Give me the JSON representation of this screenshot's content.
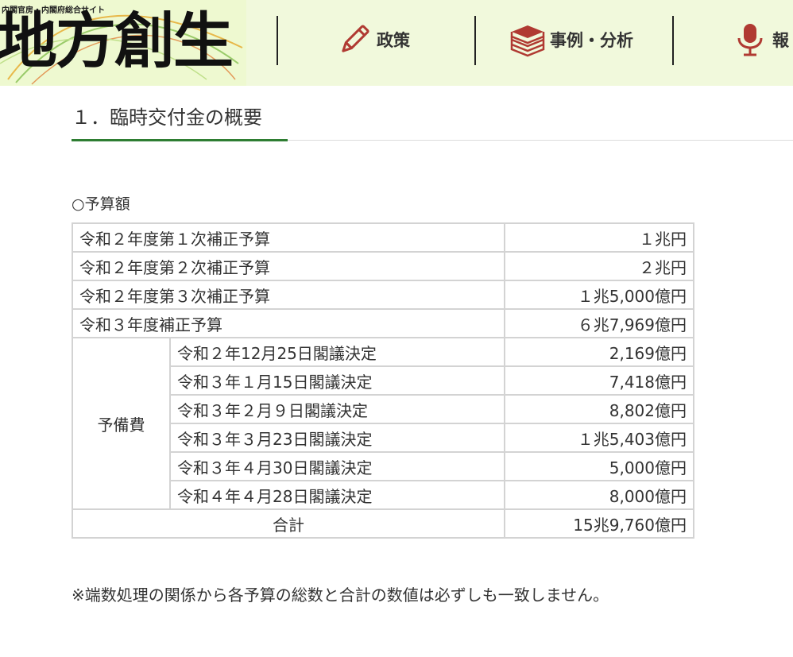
{
  "header": {
    "logo_sub": "内閣官房・内閣府総合サイト",
    "logo_main": "地方創生",
    "nav": [
      {
        "label": "政策",
        "icon": "pencil-icon"
      },
      {
        "label": "事例・分析",
        "icon": "books-icon"
      },
      {
        "label": "報",
        "icon": "microphone-icon"
      }
    ],
    "colors": {
      "header_bg": "#f1f9dc",
      "icon_red": "#b03a32"
    }
  },
  "section": {
    "title": "１．臨時交付金の概要",
    "accent_color": "#2e7d32"
  },
  "budget": {
    "label": "○予算額",
    "rows": [
      {
        "name": "令和２年度第１次補正予算",
        "amount": "１兆円"
      },
      {
        "name": "令和２年度第２次補正予算",
        "amount": "２兆円"
      },
      {
        "name": "令和２年度第３次補正予算",
        "amount": "１兆5,000億円"
      },
      {
        "name": "令和３年度補正予算",
        "amount": "６兆7,969億円"
      }
    ],
    "reserve": {
      "label": "予備費",
      "items": [
        {
          "name": "令和２年12月25日閣議決定",
          "amount": "2,169億円"
        },
        {
          "name": "令和３年１月15日閣議決定",
          "amount": "7,418億円"
        },
        {
          "name": "令和３年２月９日閣議決定",
          "amount": "8,802億円"
        },
        {
          "name": "令和３年３月23日閣議決定",
          "amount": "１兆5,403億円"
        },
        {
          "name": "令和３年４月30日閣議決定",
          "amount": "5,000億円"
        },
        {
          "name": "令和４年４月28日閣議決定",
          "amount": "8,000億円"
        }
      ]
    },
    "total": {
      "label": "合計",
      "amount": "15兆9,760億円"
    }
  },
  "note": "※端数処理の関係から各予算の総数と合計の数値は必ずしも一致しません。"
}
